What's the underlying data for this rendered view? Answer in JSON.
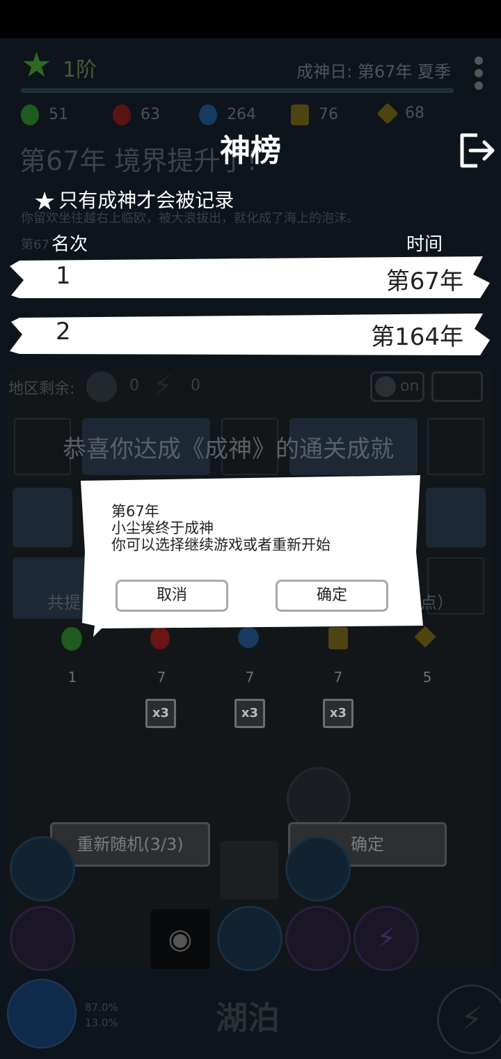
{
  "background": {
    "rank_label": "1阶",
    "date_label": "成神日: 第67年 夏季",
    "resources": [
      {
        "icon": "leaf-icon",
        "value": "51",
        "color": "#2e7d2e"
      },
      {
        "icon": "fire-icon",
        "value": "63",
        "color": "#7a1c1c"
      },
      {
        "icon": "wave-icon",
        "value": "264",
        "color": "#1c4a7a"
      },
      {
        "icon": "mountain-icon",
        "value": "76",
        "color": "#6a5a18"
      },
      {
        "icon": "diamond-icon",
        "value": "68",
        "color": "#6a5a10"
      }
    ],
    "headline": "第67年 境界提升了!",
    "line2": "你留欢坐往越右上临欧，被大浪拔出，就化成了海上的泡沫。",
    "line3": "第67",
    "region_label": "地区剩余:",
    "region_counts": [
      "0",
      "0"
    ],
    "toggle_label": "on",
    "congrats_text": "恭喜你达成《成神》的通关成就",
    "share_left": "共提",
    "share_right": "点）",
    "counts": [
      "1",
      "7",
      "7",
      "7",
      "5"
    ],
    "x3_label": "x3",
    "reroll_button": "重新随机(3/3)",
    "confirm_button": "确定",
    "location": "湖泊",
    "pct1": "87.0%",
    "pct2": "13.0%"
  },
  "leaderboard": {
    "title": "神榜",
    "note": "只有成神才会被记录",
    "col_rank": "名次",
    "col_time": "时间",
    "rows": [
      {
        "rank": "1",
        "time": "第67年"
      },
      {
        "rank": "2",
        "time": "第164年"
      }
    ]
  },
  "dialog": {
    "lines": [
      "第67年",
      "小尘埃终于成神",
      "你可以选择继续游戏或者重新开始"
    ],
    "cancel": "取消",
    "ok": "确定"
  }
}
